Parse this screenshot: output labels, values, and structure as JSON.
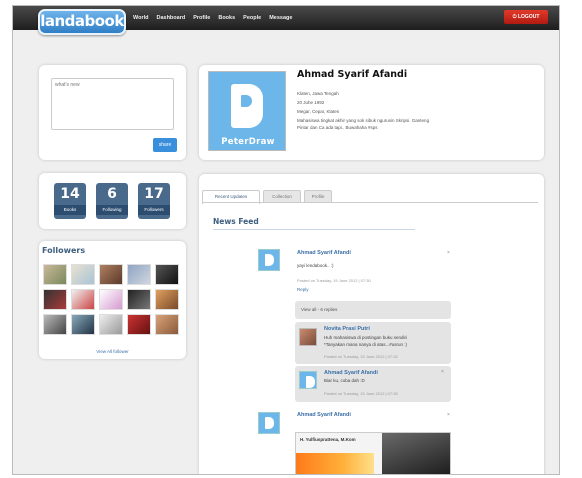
{
  "header": {
    "logo": "landabook",
    "nav": [
      "World",
      "Dashboard",
      "Profile",
      "Books",
      "People",
      "Message"
    ],
    "logout": "LOGOUT"
  },
  "status": {
    "placeholder": "what's new",
    "share": "share"
  },
  "profile": {
    "name": "Ahmad Syarif Afandi",
    "avatar_text": "PeterDraw",
    "lines": [
      "Klaten, Jawa Tengah",
      "20 Juhe 1992",
      "Megar, Cepar, Klaten",
      "Mahasiswa tingkat akhir yang sok sibuk ngurusin Skripsi. Ganteng",
      "Pintar dan Ca ada tapi.. Buwahaha #sps"
    ]
  },
  "stats": [
    {
      "value": "14",
      "label": "Books"
    },
    {
      "value": "6",
      "label": "Following"
    },
    {
      "value": "17",
      "label": "Followers"
    }
  ],
  "followers": {
    "title": "Followers",
    "view_all": "View All follower"
  },
  "tabs": [
    "Recent Updates",
    "Collection",
    "Profile"
  ],
  "feed": {
    "title": "News Feed",
    "post1": {
      "author": "Ahmad Syarif Afandi",
      "text": "yayi lendabook.. :)",
      "meta": "Posted on Tuesday, 19 June 2012 | 07:30",
      "reply": "Reply",
      "view_all": "View all - 6 replies"
    },
    "reply1": {
      "author": "Novita Prasi Putri",
      "text1": "Huh mahasiswa di postingan buku sendiri",
      "text2": "*Tanyakan mana nanya di atas...#usrun :)",
      "meta": "Posted on Tuesday, 19 June 2012 | 07:32"
    },
    "reply2": {
      "author": "Ahmad Syarif Afandi",
      "text": "Biar ku, coba dah :D",
      "meta": "Posted on Tuesday, 19 June 2012 | 07:35"
    },
    "post2": {
      "author": "Ahmad Syarif Afandi",
      "caption": "H. Yulfiusprattena, M.Kom"
    }
  }
}
